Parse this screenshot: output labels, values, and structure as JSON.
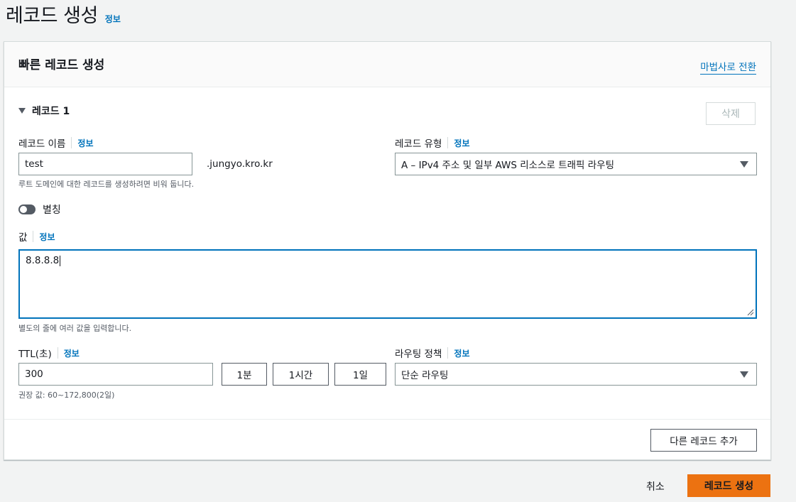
{
  "page": {
    "title": "레코드 생성",
    "info": "정보"
  },
  "panel": {
    "title": "빠른 레코드 생성",
    "switch_wizard": "마법사로 전환",
    "record": {
      "heading": "레코드 1",
      "delete_label": "삭제",
      "name": {
        "label": "레코드 이름",
        "info": "정보",
        "value": "test",
        "suffix": ".jungyo.kro.kr",
        "hint": "루트 도메인에 대한 레코드를 생성하려면 비워 둡니다."
      },
      "type": {
        "label": "레코드 유형",
        "info": "정보",
        "selected": "A – IPv4 주소 및 일부 AWS 리소스로 트래픽 라우팅"
      },
      "alias": {
        "label": "별칭",
        "enabled": false
      },
      "value": {
        "label": "값",
        "info": "정보",
        "text": "8.8.8.8",
        "hint": "별도의 줄에 여러 값을 입력합니다."
      },
      "ttl": {
        "label": "TTL(초)",
        "info": "정보",
        "value": "300",
        "presets": [
          "1분",
          "1시간",
          "1일"
        ],
        "hint": "권장 값: 60~172,800(2일)"
      },
      "routing": {
        "label": "라우팅 정책",
        "info": "정보",
        "selected": "단순 라우팅"
      }
    },
    "add_record_label": "다른 레코드 추가"
  },
  "footer": {
    "cancel_label": "취소",
    "create_label": "레코드 생성"
  },
  "colors": {
    "primary": "#ec7211",
    "link": "#0073bb",
    "focus": "#0073bb",
    "background": "#f2f3f3"
  }
}
